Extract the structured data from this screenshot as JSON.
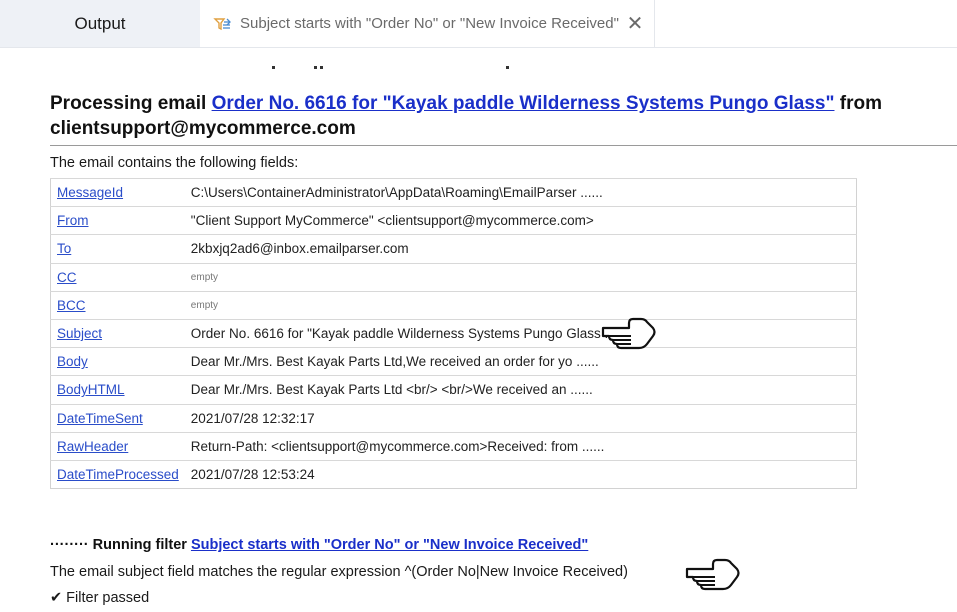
{
  "tabs": {
    "output_label": "Output",
    "filter_label": "Subject starts with \"Order No\" or \"New Invoice Received\"",
    "close_glyph": "✕"
  },
  "header": {
    "prefix": "Processing email ",
    "email_link": "Order No. 6616 for \"Kayak paddle Wilderness Systems Pungo Glass\"",
    "suffix": " from clientsupport@mycommerce.com"
  },
  "intro": "The email contains the following fields:",
  "fields": [
    {
      "name": "MessageId",
      "value": "C:\\Users\\ContainerAdministrator\\AppData\\Roaming\\EmailParser  ......"
    },
    {
      "name": "From",
      "value": "\"Client Support MyCommerce\" <clientsupport@mycommerce.com>"
    },
    {
      "name": "To",
      "value": "2kbxjq2ad6@inbox.emailparser.com"
    },
    {
      "name": "CC",
      "value": "empty"
    },
    {
      "name": "BCC",
      "value": "empty"
    },
    {
      "name": "Subject",
      "value": "Order No. 6616 for \"Kayak paddle Wilderness Systems Pungo Glass ......"
    },
    {
      "name": "Body",
      "value": "Dear Mr./Mrs. Best Kayak Parts Ltd,We received an order for yo  ......"
    },
    {
      "name": "BodyHTML",
      "value": "Dear Mr./Mrs. Best Kayak Parts Ltd <br/> <br/>We received an  ......"
    },
    {
      "name": "DateTimeSent",
      "value": "2021/07/28 12:32:17"
    },
    {
      "name": "RawHeader",
      "value": "Return-Path: <clientsupport@mycommerce.com>Received: from  ......"
    },
    {
      "name": "DateTimeProcessed",
      "value": "2021/07/28 12:53:24"
    }
  ],
  "filter_run": {
    "dots": "········ ",
    "prefix": "Running filter ",
    "filter_link": "Subject starts with \"Order No\" or \"New Invoice Received\"",
    "match_text": "The email subject field matches the regular expression ^(Order No|New Invoice Received)",
    "passed_text": "✔ Filter passed"
  },
  "icons": {
    "filter": "filter-funnel-icon",
    "close": "close-icon",
    "pointer": "pointing-hand-icon"
  },
  "colors": {
    "link": "#1a2fc9",
    "field_link": "#2a4dc9",
    "tab_active_bg": "#eef1f6"
  }
}
